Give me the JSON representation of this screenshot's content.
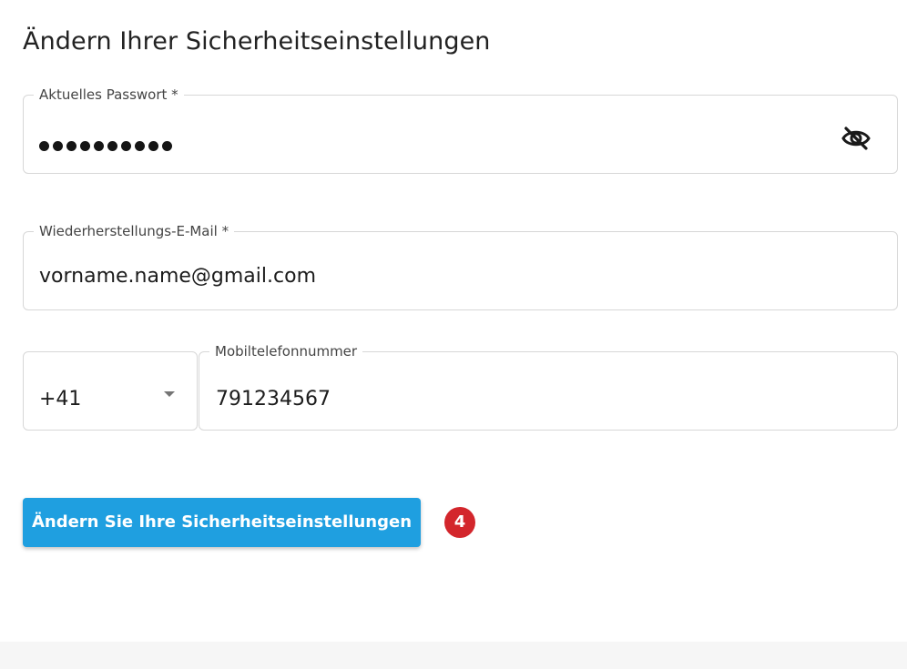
{
  "page": {
    "title": "Ändern Ihrer Sicherheitseinstellungen"
  },
  "password": {
    "label": "Aktuelles Passwort *",
    "masked_length": 10,
    "visibility_icon": "eye-off-icon"
  },
  "recovery_email": {
    "label": "Wiederherstellungs-E-Mail *",
    "value": "vorname.name@gmail.com"
  },
  "phone": {
    "country_code": "+41",
    "label": "Mobiltelefonnummer",
    "value": "791234567"
  },
  "submit": {
    "label": "Ändern Sie Ihre Sicherheitseinstellungen"
  },
  "badge": {
    "count": "4"
  },
  "colors": {
    "button": "#1f9fe0",
    "badge": "#d3262c"
  }
}
